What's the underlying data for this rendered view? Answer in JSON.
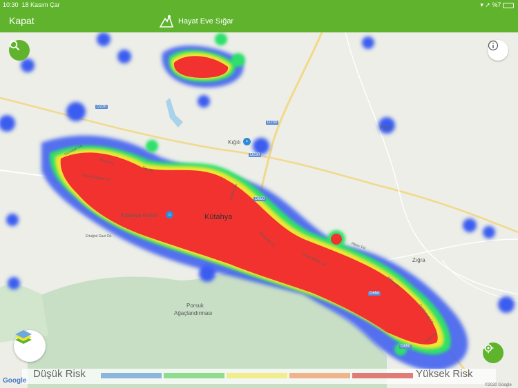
{
  "status": {
    "time": "10:30",
    "date": "18 Kasım Çar",
    "battery": "%7"
  },
  "nav": {
    "close_label": "Kapat",
    "app_title": "Hayat Eve Sığar"
  },
  "map": {
    "places": {
      "kutahya": "Kütahya",
      "kalesi": "Kütahya Kalesi",
      "kigili": "Kığılı",
      "perli": "Perli",
      "zigra": "Zığra",
      "porsuk": "Porsuk",
      "agac": "Ağaçlandırması"
    },
    "roads": [
      "D230",
      "D230",
      "D230",
      "D650",
      "D650",
      "D650"
    ],
    "streets": [
      "Hızırtepe Cd.",
      "Şirvan Cd.",
      "Hasan Dolaylar Cd.",
      "Fay Sk.",
      "Atatürk Blv.",
      "Ertuğrul Gazi Cd.",
      "Eskişehir Cd.",
      "Tunus Ekrem Cd.",
      "Adliye Cd.",
      "Cumhuriyet Cd.",
      "Zafer Cd.",
      "Aliyev Cd."
    ],
    "heat_colors": {
      "low": "#3a5bf0",
      "mid": "#2ee06a",
      "high": "#f1e530",
      "top": "#f2322e"
    }
  },
  "legend": {
    "low_label": "Düşük Risk",
    "high_label": "Yüksek Risk",
    "colors": [
      "#8db6dd",
      "#8fdc8f",
      "#f2ec8a",
      "#f1b38a",
      "#e07c78"
    ]
  },
  "footer": {
    "google": "Google",
    "copyright": "©2020 Google"
  },
  "icons": {
    "search": "search-icon",
    "info": "info-icon",
    "layers": "map-layers-icon",
    "locate": "locate-icon",
    "brand": "app-logo-icon"
  }
}
